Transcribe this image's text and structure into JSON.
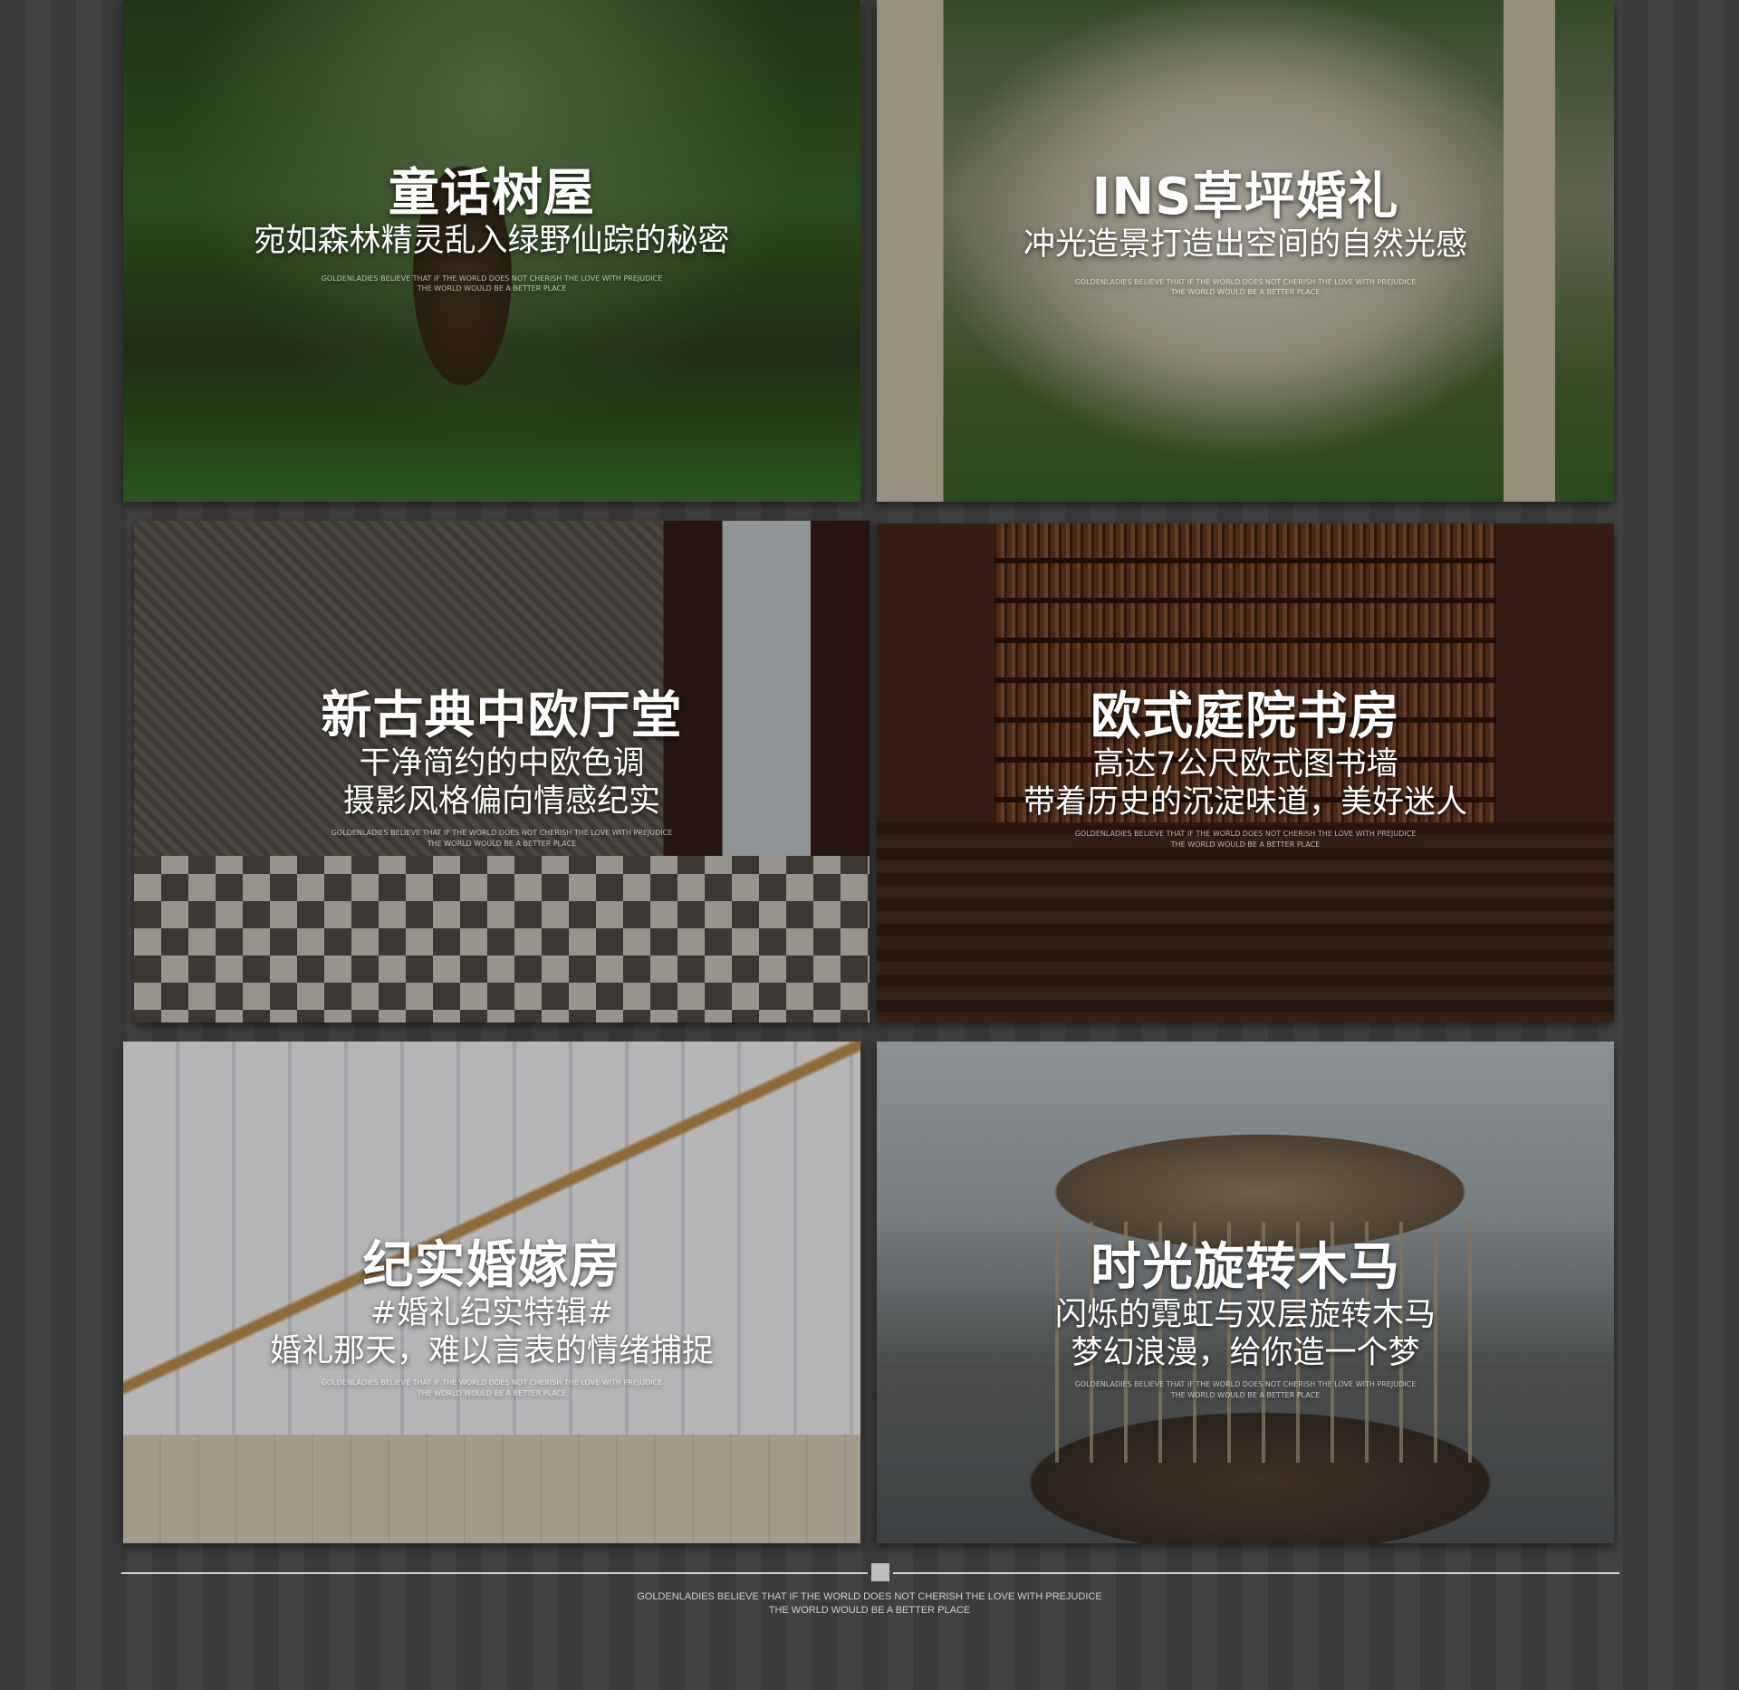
{
  "tagline": {
    "line1": "GOLDENLADIES BELIEVE THAT IF THE WORLD DOES NOT CHERISH THE LOVE WITH PREJUDICE",
    "line2": "THE WORLD WOULD BE A BETTER PLACE"
  },
  "tiles": [
    {
      "title": "童话树屋",
      "subs": [
        "宛如森林精灵乱入绿野仙踪的秘密"
      ]
    },
    {
      "title": "INS草坪婚礼",
      "subs": [
        "冲光造景打造出空间的自然光感"
      ]
    },
    {
      "title": "新古典中欧厅堂",
      "subs": [
        "干净简约的中欧色调",
        "摄影风格偏向情感纪实"
      ]
    },
    {
      "title": "欧式庭院书房",
      "subs": [
        "高达7公尺欧式图书墙",
        "带着历史的沉淀味道，美好迷人"
      ]
    },
    {
      "title": "纪实婚嫁房",
      "subs": [
        "#婚礼纪实特辑#",
        "婚礼那天，难以言表的情绪捕捉"
      ]
    },
    {
      "title": "时光旋转木马",
      "subs": [
        "闪烁的霓虹与双层旋转木马",
        "梦幻浪漫，给你造一个梦"
      ]
    }
  ]
}
